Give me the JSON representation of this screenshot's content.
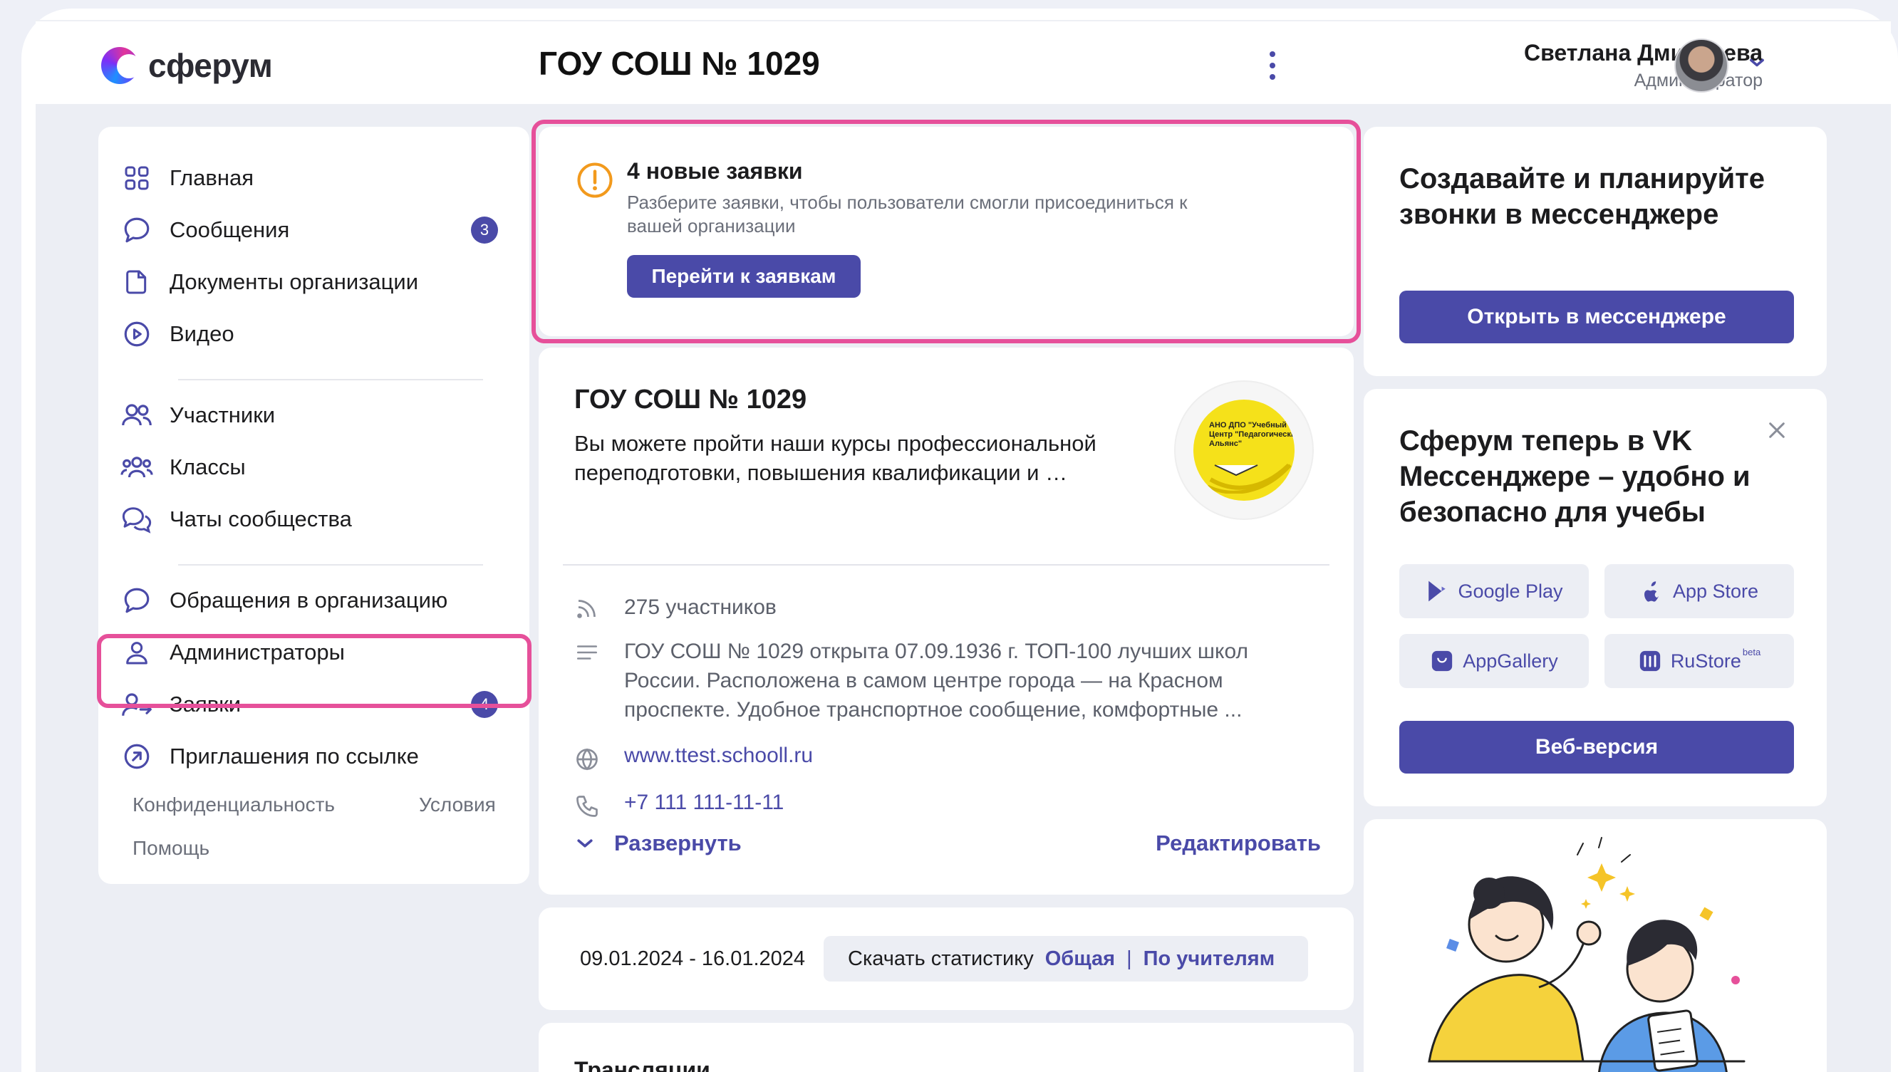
{
  "app": {
    "logo_text": "сферум"
  },
  "header": {
    "org_title": "ГОУ СОШ № 1029",
    "user_name": "Светлана Дмитриева",
    "user_role": "Администратор"
  },
  "sidebar": {
    "items": [
      {
        "label": "Главная",
        "icon": "home-grid-icon"
      },
      {
        "label": "Сообщения",
        "icon": "message-bubble-icon",
        "badge": "3"
      },
      {
        "label": "Документы организации",
        "icon": "document-icon"
      },
      {
        "label": "Видео",
        "icon": "play-circle-icon"
      },
      {
        "label": "Участники",
        "icon": "users-icon"
      },
      {
        "label": "Классы",
        "icon": "group-icon"
      },
      {
        "label": "Чаты сообщества",
        "icon": "chats-icon"
      },
      {
        "label": "Обращения в организацию",
        "icon": "message-bubble-icon"
      },
      {
        "label": "Администраторы",
        "icon": "user-icon"
      },
      {
        "label": "Заявки",
        "icon": "user-arrow-icon",
        "badge": "4"
      },
      {
        "label": "Приглашения по ссылке",
        "icon": "link-arrow-icon"
      }
    ],
    "footer": {
      "privacy": "Конфиденциальность",
      "terms": "Условия",
      "help": "Помощь"
    }
  },
  "notice": {
    "title": "4 новые заявки",
    "text": "Разберите заявки, чтобы пользователи смогли присоединиться к вашей организации",
    "button": "Перейти к заявкам"
  },
  "org": {
    "title": "ГОУ СОШ № 1029",
    "description": "Вы можете пройти наши курсы профессиональной переподготовки, повышения квалификации и …",
    "logo_text": "АНО ДПО \"Учебный Центр \"Педагогический Альянс\"",
    "members": "275 участников",
    "about": "ГОУ СОШ № 1029 открыта 07.09.1936 г. ТОП-100 лучших школ России. Расположена в самом центре города — на Красном проспекте. Удобное транспортное сообщение, комфортные ...",
    "website": "www.ttest.schooll.ru",
    "phone": "+7 111 111-11-11",
    "expand": "Развернуть",
    "edit": "Редактировать"
  },
  "stats": {
    "date_range": "09.01.2024 - 16.01.2024",
    "download_label": "Скачать статистику",
    "general": "Общая",
    "separator": "|",
    "by_teachers": "По учителям"
  },
  "broadcasts": {
    "title": "Трансляции"
  },
  "promo_calls": {
    "title": "Создавайте и планируйте звонки в мессенджере",
    "button": "Открыть в мессенджере"
  },
  "promo_apps": {
    "title": "Сферум теперь в VK Мессенджере – удобно и безопасно для учебы",
    "stores": [
      {
        "label": "Google Play",
        "icon": "google-play-icon"
      },
      {
        "label": "App Store",
        "icon": "apple-icon"
      },
      {
        "label": "AppGallery",
        "icon": "appgallery-icon"
      },
      {
        "label": "RuStore",
        "icon": "rustore-icon",
        "tag": "beta"
      }
    ],
    "web_button": "Веб-версия"
  },
  "colors": {
    "accent": "#4a4aa8",
    "highlight": "#e6509a",
    "warning": "#f29a1d"
  }
}
